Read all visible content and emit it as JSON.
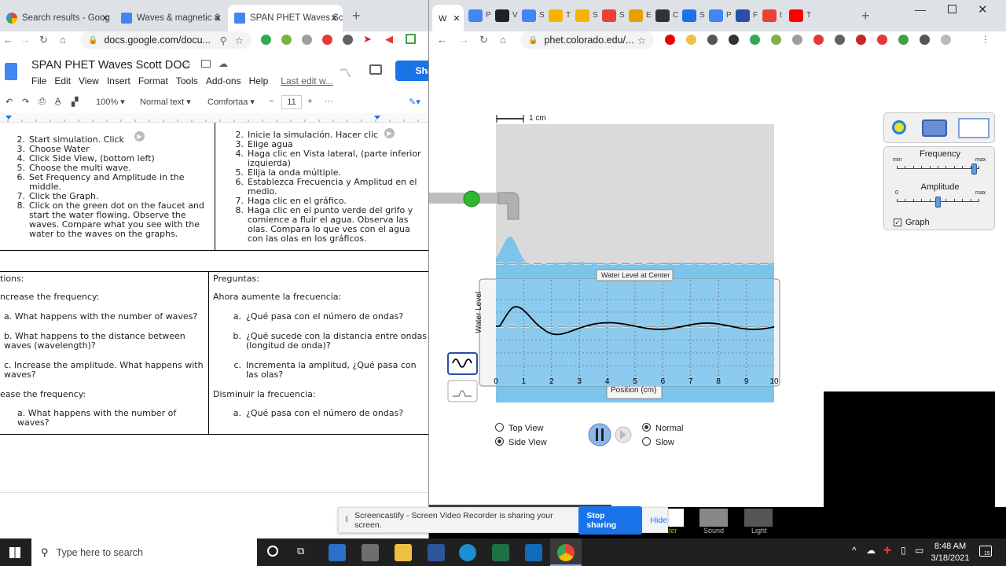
{
  "left_tabs": [
    {
      "title": "Search results - Goog",
      "color": "#4285f4"
    },
    {
      "title": "Waves & magnetic &",
      "color": "#4285f4"
    },
    {
      "title": "SPAN PHET Waves Sc",
      "color": "#4285f4"
    }
  ],
  "left_url": "docs.google.com/docu...",
  "doc": {
    "title": "SPAN PHET Waves Scott DOC",
    "menu": [
      "File",
      "Edit",
      "View",
      "Insert",
      "Format",
      "Tools",
      "Add-ons",
      "Help"
    ],
    "last_edit": "Last edit w...",
    "share": "Sha",
    "zoom": "100%",
    "style": "Normal text",
    "font": "Comfortaa",
    "font_size": "11",
    "en_steps": [
      {
        "n": "2.",
        "t": "Start simulation.  Click"
      },
      {
        "n": "3.",
        "t": "Choose Water"
      },
      {
        "n": "4.",
        "t": "Click Side View, (bottom left)"
      },
      {
        "n": "5.",
        "t": "Choose the multi wave."
      },
      {
        "n": "6.",
        "t": "Set Frequency and Amplitude in the middle."
      },
      {
        "n": "7.",
        "t": "Click the Graph."
      },
      {
        "n": "8.",
        "t": "Click on the green dot on the faucet and start the water flowing.  Observe the waves.  Compare what you see with the water to the waves on the graphs."
      }
    ],
    "es_steps": [
      {
        "n": "2.",
        "t": "Inicie la simulación. Hacer clic"
      },
      {
        "n": "3.",
        "t": "Elige agua"
      },
      {
        "n": "4.",
        "t": "Haga clic en Vista lateral, (parte inferior izquierda)"
      },
      {
        "n": "5.",
        "t": "Elija la onda múltiple."
      },
      {
        "n": "6.",
        "t": "Establezca Frecuencia y Amplitud en el medio."
      },
      {
        "n": "7.",
        "t": "Haga clic en el gráfico."
      },
      {
        "n": "8.",
        "t": "Haga clic en el punto verde del grifo y comience a fluir el agua. Observa las olas. Compara lo que ves con el agua con las olas en los gráficos."
      }
    ],
    "en_q": {
      "heading": "tions:",
      "sub1": "ncrease the frequency:",
      "a": "a.  What happens with the number of waves?",
      "b": "b. What happens to the distance between waves (wavelength)?",
      "c": "c. Increase the amplitude.  What happens with waves?",
      "sub2": "ease the frequency:",
      "a2": "a.   What happens with the number of waves?"
    },
    "es_q": {
      "heading": "Preguntas:",
      "sub1": "Ahora aumente la frecuencia:",
      "a": "¿Qué pasa con el número de ondas?",
      "b": "¿Qué sucede con la distancia entre ondas (longitud de onda)?",
      "c": "Incrementa la amplitud, ¿Qué pasa con las olas?",
      "sub2": "Disminuir la frecuencia:",
      "a2": "¿Qué pasa con el número de ondas?"
    }
  },
  "right_tab_letters": [
    "W",
    "P",
    "V",
    "S",
    "T",
    "S",
    "S",
    "E",
    "C",
    "S",
    "P",
    "F",
    "t",
    "T"
  ],
  "right_url": "phet.colorado.edu/...",
  "sim": {
    "scale": "1 cm",
    "graph_title": "Water Level at Center",
    "ylabel": "Water Level",
    "xlabel": "Position (cm)",
    "ticks": [
      "0",
      "1",
      "2",
      "3",
      "4",
      "5",
      "6",
      "7",
      "8",
      "9",
      "10"
    ],
    "frequency_label": "Frequency",
    "amplitude_label": "Amplitude",
    "freq_min": "min",
    "freq_max": "max",
    "amp_min": "0",
    "amp_max": "max",
    "frequency_value": 0.95,
    "amplitude_value": 0.5,
    "graph_label": "Graph",
    "view_top": "Top View",
    "view_side": "Side View",
    "speed_normal": "Normal",
    "speed_slow": "Slow",
    "bottom_tabs": [
      "ater",
      "Sound",
      "Light"
    ]
  },
  "notification": {
    "text": "Screencastify - Screen Video Recorder is sharing your screen.",
    "stop": "Stop sharing",
    "hide": "Hide"
  },
  "taskbar": {
    "search": "Type here to search",
    "time": "8:48 AM",
    "date": "3/18/2021",
    "notif_count": "15"
  }
}
